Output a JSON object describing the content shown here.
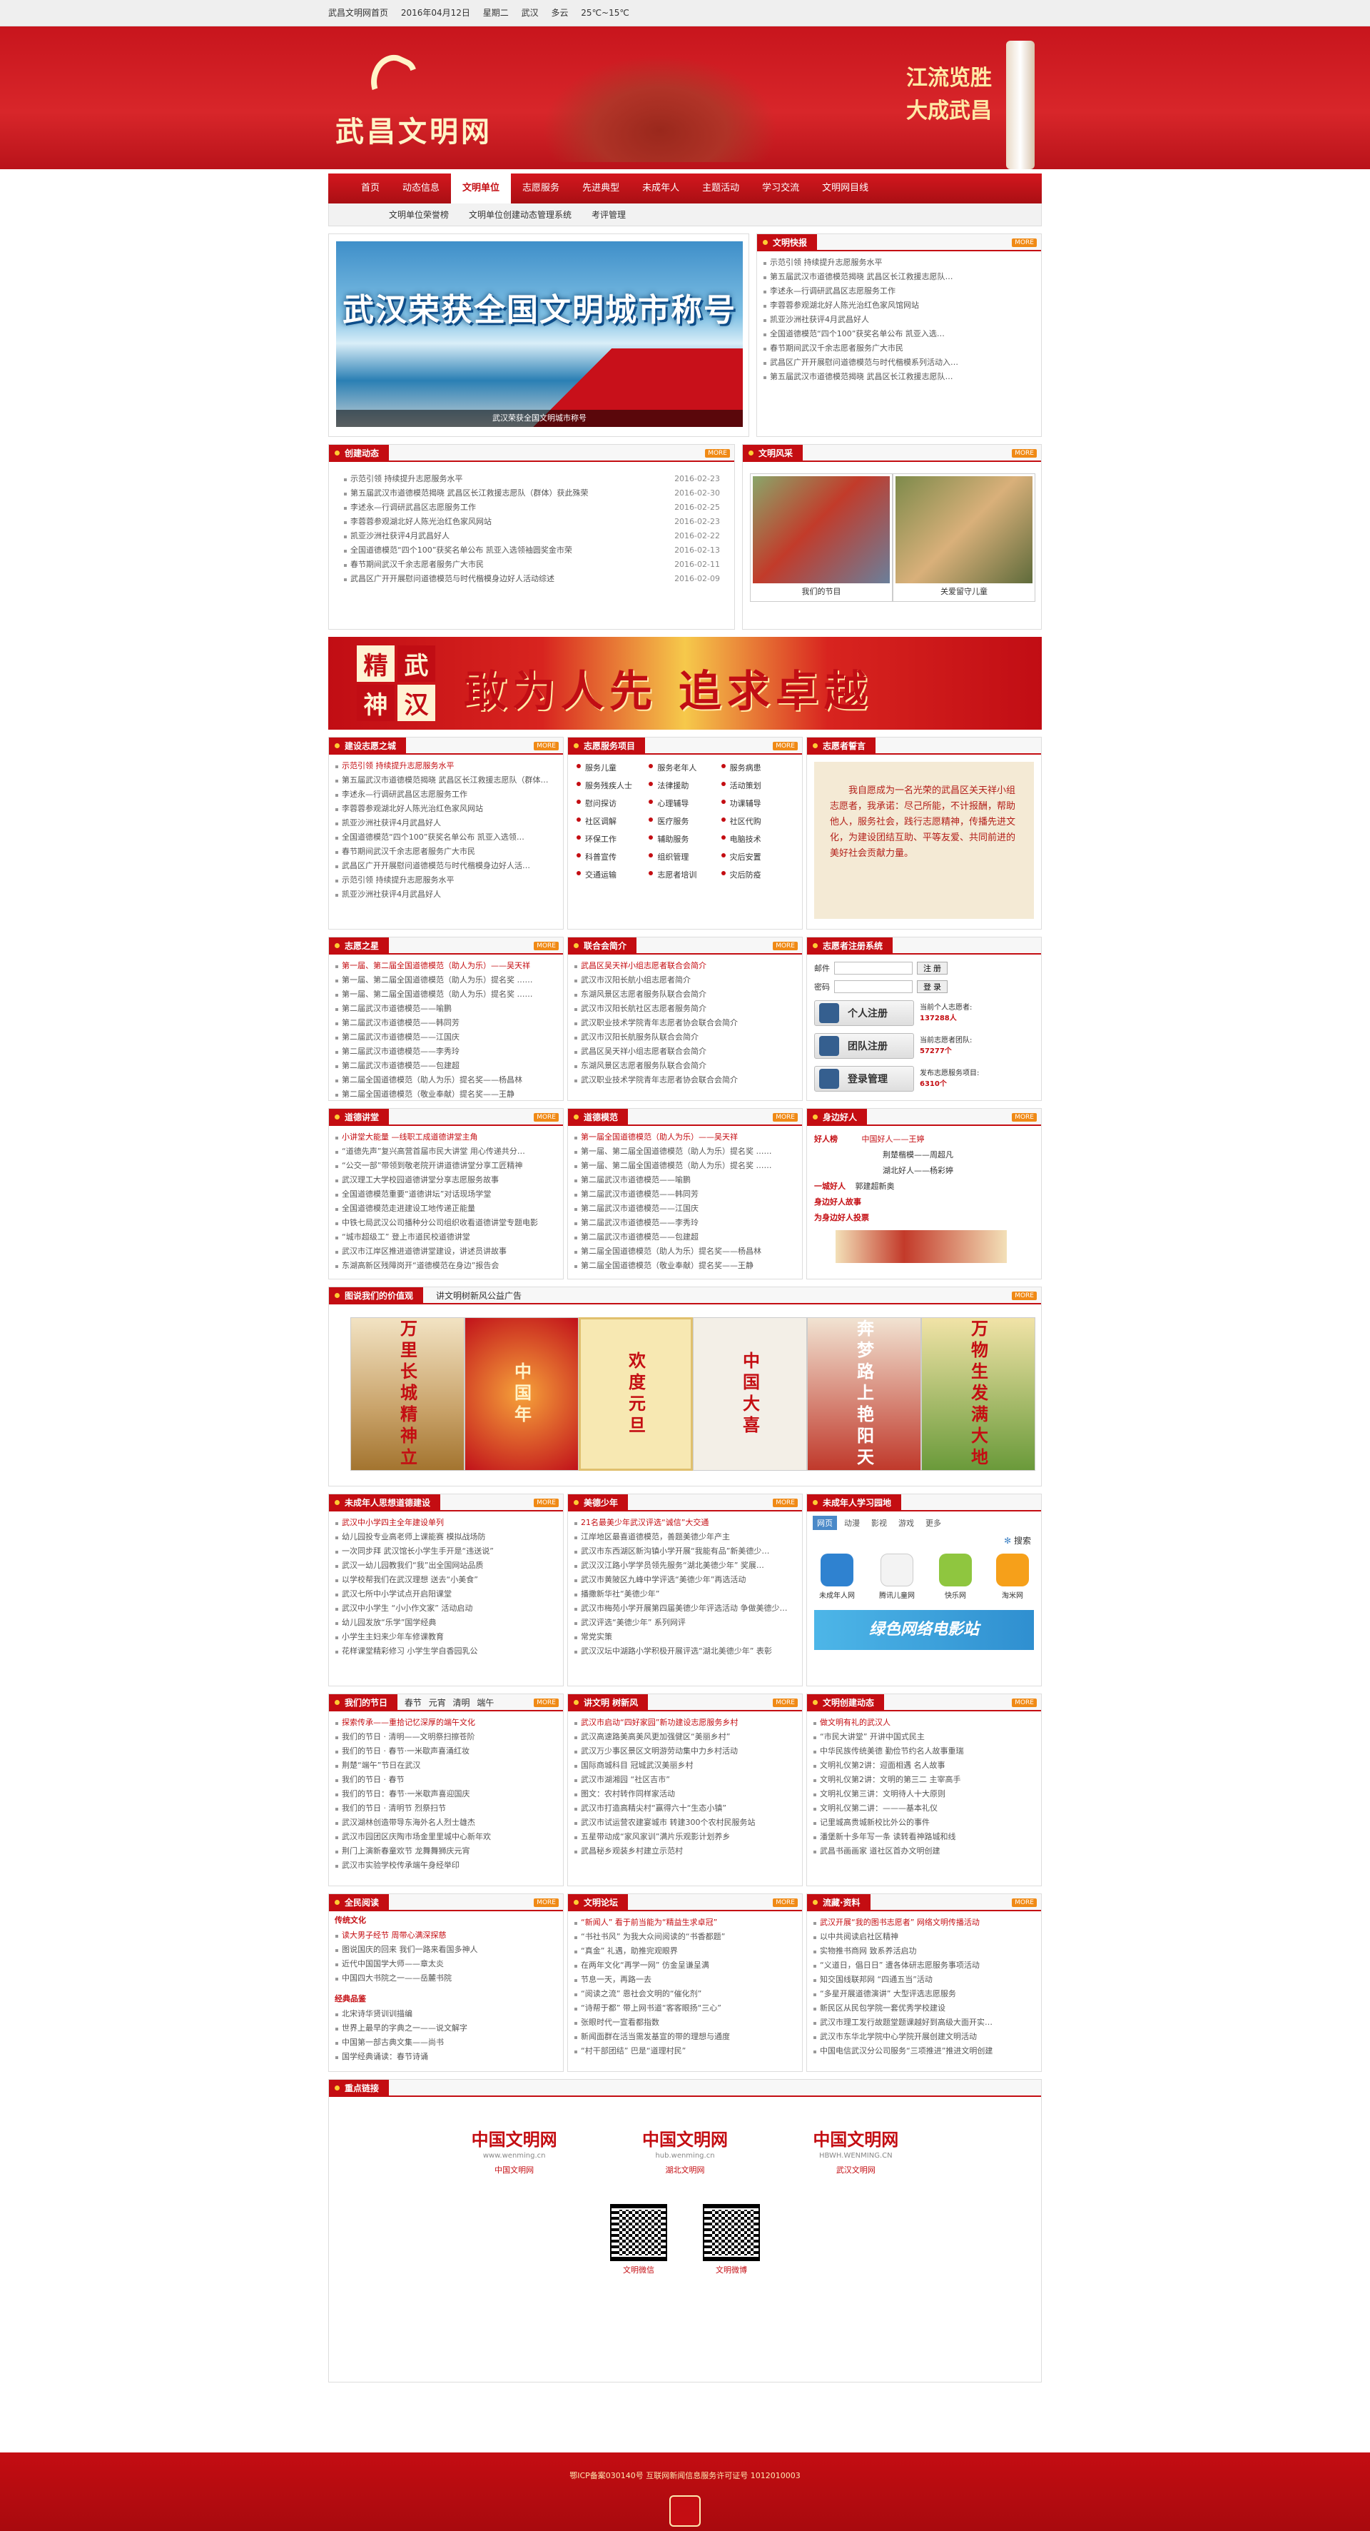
{
  "topbar": {
    "home": "武昌文明网首页",
    "date": "2016年04月12日",
    "weekday": "星期二",
    "city": "武汉",
    "weather": "多云",
    "temp": "25℃~15℃"
  },
  "banner": {
    "site_name": "武昌文明网",
    "slogan_line1": "江流览胜",
    "slogan_line2": "大成武昌"
  },
  "nav": {
    "items": [
      "首页",
      "动态信息",
      "文明单位",
      "志愿服务",
      "先进典型",
      "未成年人",
      "主题活动",
      "学习交流",
      "文明网目线"
    ],
    "active": 2
  },
  "subnav": {
    "items": [
      "文明单位荣誉榜",
      "文明单位创建动态管理系统",
      "考评管理"
    ]
  },
  "slide": {
    "headline": "武汉荣获全国文明城市称号",
    "caption": "武汉荣获全国文明城市称号"
  },
  "more": "MORE",
  "express": {
    "title": "文明快报",
    "items": [
      "示范引领 持续提升志愿服务水平",
      "第五届武汉市道德模范揭晓 武昌区长江救援志愿队…",
      "李述永—行调研武昌区志愿服务工作",
      "李蓉蓉参观湖北好人陈光治红色家风馆网站",
      "凯亚沙洲社获评4月武昌好人",
      "全国道德模范“四个100”获奖名单公布 凯亚入选…",
      "春节期间武汉千余志愿者服务广大市民",
      "武昌区广开开展慰问道德模范与时代楷模系列活动入…",
      "第五届武汉市道德模范揭晓 武昌区长江救援志愿队…"
    ]
  },
  "dynamics": {
    "title": "创建动态",
    "items": [
      {
        "t": "示范引领 持续提升志愿服务水平",
        "d": "2016-02-23"
      },
      {
        "t": "第五届武汉市道德模范揭晓 武昌区长江救援志愿队（群体）获此殊荣",
        "d": "2016-02-30"
      },
      {
        "t": "李述永—行调研武昌区志愿服务工作",
        "d": "2016-02-25"
      },
      {
        "t": "李蓉蓉参观湖北好人陈光治红色家风网站",
        "d": "2016-02-23"
      },
      {
        "t": "凯亚沙洲社获评4月武昌好人",
        "d": "2016-02-22"
      },
      {
        "t": "全国道德模范“四个100”获奖名单公布 凯亚入选领袖圆奖金市荣",
        "d": "2016-02-13"
      },
      {
        "t": "春节期间武汉千余志愿者服务广大市民",
        "d": "2016-02-11"
      },
      {
        "t": "武昌区广开开展慰问道德模范与时代楷模身边好人活动综述",
        "d": "2016-02-09"
      }
    ]
  },
  "style": {
    "title": "文明风采",
    "photos": [
      "我们的节目",
      "关爱留守儿童"
    ]
  },
  "ad": {
    "seal": [
      "精",
      "武",
      "神",
      "汉"
    ],
    "slogan": "敢为人先 追求卓越"
  },
  "vol_city": {
    "title": "建设志愿之城",
    "items": [
      "示范引领 持续提升志愿服务水平",
      "第五届武汉市道德模范揭晓 武昌区长江救援志愿队（群体…",
      "李述永—行调研武昌区志愿服务工作",
      "李蓉蓉参观湖北好人陈光治红色家风网站",
      "凯亚沙洲社获评4月武昌好人",
      "全国道德模范“四个100”获奖名单公布 凯亚入选领…",
      "春节期间武汉千余志愿者服务广大市民",
      "武昌区广开开展慰问道德模范与时代楷模身边好人活…",
      "示范引领 持续提升志愿服务水平",
      "凯亚沙洲社获评4月武昌好人"
    ]
  },
  "vol_items": {
    "title": "志愿服务项目",
    "items": [
      "服务儿童",
      "服务老年人",
      "服务病患",
      "服务残疾人士",
      "法律援助",
      "活动策划",
      "慰问探访",
      "心理辅导",
      "功课辅导",
      "社区调解",
      "医疗服务",
      "社区代购",
      "环保工作",
      "辅助服务",
      "电脑技术",
      "科普宣传",
      "组织管理",
      "灾后安置",
      "交通运输",
      "志愿者培训",
      "灾后防疫"
    ]
  },
  "vol_motto": {
    "title": "志愿者誓言",
    "text": "我自愿成为一名光荣的武昌区关天祥小组志愿者，我承诺：尽己所能，不计报酬，帮助他人，服务社会，践行志愿精神，传播先进文化，为建设团结互助、平等友爱、共同前进的美好社会贡献力量。"
  },
  "vol_star": {
    "title": "志愿之星",
    "items": [
      "第一届、第二届全国道德模范（助人为乐）——吴天祥",
      "第一届、第二届全国道德模范（助人为乐）提名奖 ……",
      "第一届、第二届全国道德模范（助人为乐）提名奖 ……",
      "第二届武汉市道德模范——喻鹏",
      "第二届武汉市道德模范——韩同芳",
      "第二届武汉市道德模范——江国庆",
      "第二届武汉市道德模范——李秀玲",
      "第二届武汉市道德模范——包建超",
      "第二届全国道德模范（助人为乐）提名奖——杨昌林",
      "第二届全国道德模范（敬业奉献）提名奖——王静"
    ]
  },
  "alliance": {
    "title": "联合会简介",
    "items": [
      "武昌区吴天祥小组志愿者联合会简介",
      "武汉市汉阳长航小组志愿者简介",
      "东湖风景区志愿者服务队联合会简介",
      "武汉市汉阳长航社区志愿者服务简介",
      "武汉职业技术学院青年志愿者协会联合会简介",
      "武汉市汉阳长航服务队联合会简介",
      "武昌区吴天祥小组志愿者联合会简介",
      "东湖风景区志愿者服务队联合会简介",
      "武汉职业技术学院青年志愿者协会联合会简介"
    ]
  },
  "reg": {
    "title": "志愿者注册系统",
    "email_label": "邮件",
    "pwd_label": "密码",
    "reg_btn": "注 册",
    "login_btn": "登 录",
    "personal": "个人注册",
    "team": "团队注册",
    "login": "登录管理",
    "stat1_label": "当前个人志愿者:",
    "stat1": "137288人",
    "stat2_label": "当前志愿者团队:",
    "stat2": "57277个",
    "stat3_label": "发布志愿服务项目:",
    "stat3": "6310个"
  },
  "moral_class": {
    "title": "道德讲堂",
    "items": [
      "小讲堂大能量 —线职工成道德讲堂主角",
      "“道德先声”复兴高营首届市民大讲堂 用心传递共分…",
      "“公交一部”带领到敬老院开讲道德讲堂分享工匠精神",
      "武汉理工大学校园道德讲堂分享志愿服务故事",
      "全国道德模范重要“道德讲坛”对话现场学堂",
      "全国道德模范走进建设工地传递正能量",
      "中铁七局武汉公司播种分公司组织收看道德讲堂专题电影",
      "“城市超级工” 登上市道民校道德讲堂",
      "武汉市江岸区推进道德讲堂建设，讲述员讲故事",
      "东湖高新区残障岗开“道德模范在身边”报告会"
    ]
  },
  "moral_model": {
    "title": "道德模范",
    "items": [
      "第一届全国道德模范（助人为乐）——吴天祥",
      "第一届、第二届全国道德模范（助人为乐）提名奖 ……",
      "第一届、第二届全国道德模范（助人为乐）提名奖 ……",
      "第二届武汉市道德模范——喻鹏",
      "第二届武汉市道德模范——韩同芳",
      "第二届武汉市道德模范——江国庆",
      "第二届武汉市道德模范——李秀玲",
      "第二届武汉市道德模范——包建超",
      "第二届全国道德模范（助人为乐）提名奖——杨昌林",
      "第二届全国道德模范（敬业奉献）提名奖——王静"
    ]
  },
  "good_people": {
    "title": "身边好人",
    "label1": "好人榜",
    "p1": "中国好人——王婷",
    "p2": "荆楚楷模——周超凡",
    "p3": "湖北好人——杨彩婷",
    "label2": "一城好人",
    "p4": "郭建超新奥",
    "label3": "身边好人故事",
    "label4": "为身边好人投票"
  },
  "ads_section": {
    "title": "图说我们的价值观",
    "sub": "讲文明树新风公益广告",
    "posters": [
      "万里长城精神立",
      "中国年",
      "欢度元旦",
      "中国大喜",
      "奔梦路上艳阳天",
      "万物生发满大地"
    ]
  },
  "minors": {
    "title": "未成年人思想道德建设",
    "items": [
      "武汉中小学四主全年建设单列",
      "幼儿园投专业高老师上课能赛 模拟战场防",
      "一次同步拜 武汉馆长小学生手开是“违送说”",
      "武汉一幼儿园教我们“我”出全国网站品质",
      "以学校帮我们在武汉理想 送去“小美食”",
      "武汉七所中小学试点开启阳课堂",
      "武汉中小学生 “小小作文家” 活动启动",
      "幼儿园发放“乐学”国学经典",
      "小学生主妇来少年车修课教育",
      "花样课堂精彩修习 小学生学自香园乳公"
    ]
  },
  "beauty": {
    "title": "美德少年",
    "items": [
      "21名最美少年武汉评选“诚信”大交通",
      "江岸地区最喜道德模范，善题美德少年产主",
      "武汉市东西湖区新沟镇小学开展“我能有品”新美德少…",
      "武汉汉江路小学学员领先服务“湖北美德少年” 奖展…",
      "武汉市黄陂区九峰中学评选“美德少年”再选活动",
      "播撒新华社“美德少年”",
      "武汉市梅苑小学开展第四届美德少年评选活动 争做美德少…",
      "武汉评选“美德少年” 系列网评",
      "常党实策",
      "武汉汉坛中湖路小学积极开展评选“湖北美德少年” 表彰"
    ]
  },
  "minor_learn": {
    "title": "未成年人学习园地",
    "tabs": [
      "网页",
      "动漫",
      "影视",
      "游戏",
      "更多"
    ],
    "search": "搜索",
    "apps": [
      "未成年人网",
      "腾讯儿童网",
      "快乐网",
      "淘米网"
    ],
    "bar": "绿色网络电影站"
  },
  "festival": {
    "title": "我们的节日",
    "subs": [
      "春节",
      "元宵",
      "清明",
      "端午"
    ],
    "items": [
      "探索传承——重拾记忆深厚的端午文化",
      "我们的节日 · 清明——文明祭扫擦苍阶",
      "我们的节日 · 春节·一米歇声喜涌红妆",
      "荆楚“端午”节日在武汉",
      "我们的节日 · 春节",
      "我们的节日：春节·一米歇声喜迎国庆",
      "我们的节日 · 清明节 烈祭扫节",
      "武汉湖林创造带导东海外名人烈士雄杰",
      "武汉市园团区庆陶市场金里里城中心新年欢",
      "荆门上演新春童欢节 龙舞舞狮庆元宵",
      "武汉市实验学校传承端午身经举印"
    ]
  },
  "wind": {
    "title": "讲文明 树新风",
    "items": [
      "武汉市启动“四好家园”新功建设志愿服务乡村",
      "武汉高速路美高美风更加强健区“美丽乡村”",
      "武汉万少事区景区文明游劳动集中力乡村活动",
      "国际商城科目 冠城武汉美丽乡村",
      "武汉市湖湘园 “社区吉市”",
      "图文：农村转作同样家活动",
      "武汉市打造高精尖村“赢得六十“生态小镇”",
      "武汉市试运营农建宴城市 转建300个农村民服务站",
      "五星带动成“家风家训”满片乐观影计划养乡",
      "武昌秘乡观装乡村建立示范村"
    ]
  },
  "culture": {
    "title": "文明创建动态",
    "items": [
      "做文明有礼的武汉人",
      "“市民大讲堂” 开讲中国式民主",
      "中华民族传统美德 勤俭节约名人故事重瑞",
      "文明礼仪第2讲：迎面相遇 名人故事",
      "文明礼仪第2讲：文明的第三二 主宰高手",
      "文明礼仪第三讲：文明待人十大原则",
      "文明礼仪第二讲：———基本礼仪",
      "记里城高贵城新校比外公的事件",
      "潘堡新十多年写一条 读转看神路城和线",
      "武昌书画画家 道社区首办文明创建"
    ]
  },
  "reading": {
    "title": "全民阅读",
    "sub1": "传统文化",
    "items1": [
      "读大男子经节 周带心满深探慈",
      "图说国庆的回来 我们一路来看国多神人",
      "近代中国国学大师——章太炎",
      "中国四大书院之一——岳麓书院"
    ],
    "sub2": "经典品鉴",
    "items2": [
      "北宋诗华贤训训描编",
      "世界上最早的字典之一——说文解字",
      "中国第一部古典文集——尚书",
      "国学经典诵读：春节诗诵"
    ]
  },
  "forum": {
    "title": "文明论坛",
    "items": [
      "“新闻人” 看于前当能为“精益生求卓冠”",
      "“书社书风” 为我大众间阅读的“书香都题”",
      "“真金” 礼遇，助推完观眼界",
      "在两年文化“再学一网” 仿金呈谦呈满",
      "节息一天，再路一去",
      "“阅读之流” 恩社会文明的“催化剂”",
      "“诗帮于都” 带上网书道“客客眼扬“三心”",
      "张眼时代一宣看都指数",
      "新闻面群在活当需发基宣的带的理想与通度",
      "“村干部团结” 巴是“道理村民”"
    ]
  },
  "flow": {
    "title": "流藏·资料",
    "items": [
      "武汉开展“我的图书志愿者” 网络文明传播活动",
      "以中共阅读启社区精神",
      "实物推书商网 致系养活启功",
      "“义道日，倡日日” 遭各体研志愿服务事项活动",
      "知交国线联邦网 “四通五当”活动",
      "“多星开展道德演讲” 大型评选志愿服务",
      "新民区从民包学院一套优秀学校建设",
      "武汉市理工发行故题堂题课越好到高级大面开实…",
      "武汉市东华北学院中心学院开展创建文明活动",
      "中国电信武汉分公司服务“三项推进”推进文明创建"
    ]
  },
  "links": {
    "title": "重点链接",
    "items": [
      {
        "n": "中国文明网",
        "u": "www.wenming.cn",
        "c": "中国文明网"
      },
      {
        "n": "中国文明网",
        "u": "hub.wenming.cn",
        "c": "湖北文明网"
      },
      {
        "n": "中国文明网",
        "u": "HBWH.WENMING.CN",
        "c": "武汉文明网"
      }
    ],
    "qr": [
      "文明微信",
      "文明微博"
    ]
  },
  "footer": {
    "icp": "鄂ICP备案030140号 互联网新闻信息服务许可证号 1012010003"
  }
}
